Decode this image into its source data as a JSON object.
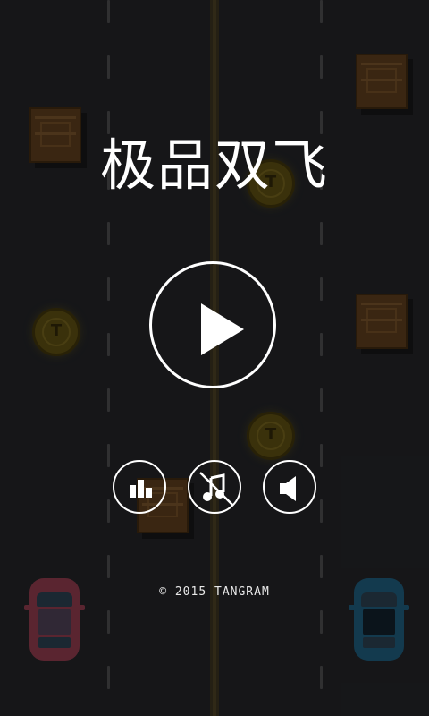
{
  "game": {
    "title": "极品双飞",
    "copyright": "© 2015 TANGRAM"
  },
  "buttons": {
    "play": "play-icon",
    "leaderboard": "bar-chart-icon",
    "music": "music-muted-icon",
    "sound": "speaker-icon"
  },
  "colors": {
    "background": "#222326",
    "overlay": "rgba(0,0,0,0.35)",
    "ui": "#ffffff",
    "crate": "#5a3b1c",
    "coin": "#5a4c12",
    "car_left": "#8a3a4a",
    "car_right": "#1e5a78"
  }
}
